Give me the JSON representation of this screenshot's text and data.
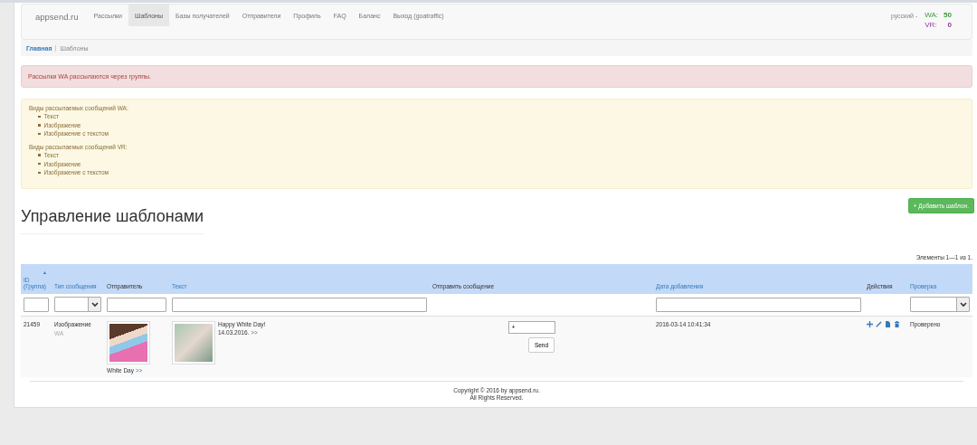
{
  "navbar": {
    "brand": "appsend.ru",
    "items": [
      {
        "label": "Рассылки",
        "selected": false
      },
      {
        "label": "Шаблоны",
        "selected": true
      },
      {
        "label": "Базы получателей",
        "selected": false
      },
      {
        "label": "Отправители",
        "selected": false
      },
      {
        "label": "Профиль",
        "selected": false
      },
      {
        "label": "FAQ",
        "selected": false
      },
      {
        "label": "Баланс",
        "selected": false
      },
      {
        "label": "Выход (goatraffic)",
        "selected": false
      }
    ],
    "language": "русский -",
    "balances": [
      {
        "label": "WA:",
        "value": "50",
        "kind": "wa"
      },
      {
        "label": "VR:",
        "value": "0",
        "kind": "vr"
      }
    ]
  },
  "breadcrumb": [
    {
      "label": "Главная",
      "kind": "link"
    },
    {
      "label": "Шаблоны",
      "kind": "current"
    }
  ],
  "alert": "Рассылки WA рассылаются через группы.",
  "info": [
    {
      "title": "Виды рассылаемых сообщений WA:",
      "items": [
        "Текст",
        "Изображение",
        "Изображение с текстом"
      ]
    },
    {
      "title": "Виды рассылаемых сообщений VR:",
      "items": [
        "Текст",
        "Изображение",
        "Изображение с текстом"
      ]
    }
  ],
  "heading": "Управление шаблонами",
  "add_button": "+ Добавить шаблон.",
  "summary": "Элементы 1—1 из 1.",
  "table": {
    "columns": [
      {
        "label": "ID (Группа)",
        "sort_mark": "▲",
        "sortable": true,
        "kind": "text"
      },
      {
        "label": "Тип сообщения",
        "sortable": true,
        "kind": "select"
      },
      {
        "label": "Отправитель",
        "sortable": false,
        "kind": "text"
      },
      {
        "label": "Текст",
        "sortable": true,
        "kind": "text"
      },
      {
        "label": "Отправить сообщение",
        "sortable": false,
        "kind": "none"
      },
      {
        "label": "Дата добавления",
        "sortable": true,
        "kind": "text"
      },
      {
        "label": "Действия",
        "sortable": false,
        "kind": "none"
      },
      {
        "label": "Проверка",
        "sortable": true,
        "kind": "select"
      }
    ],
    "rows": [
      {
        "id": "21459",
        "type": "Изображение",
        "channel": "WA",
        "sender_caption": "White Day",
        "sender_link": ">>",
        "text_title": "Happy White Day!",
        "text_date": "14.03.2016.",
        "text_link": ">>",
        "send_value": "+",
        "send_button": "Send",
        "date_added": "2016-03-14 10:41:34",
        "status": "Проверено"
      }
    ]
  },
  "footer": [
    "Copyright © 2016 by appsend.ru.",
    "All Rights Reserved."
  ]
}
